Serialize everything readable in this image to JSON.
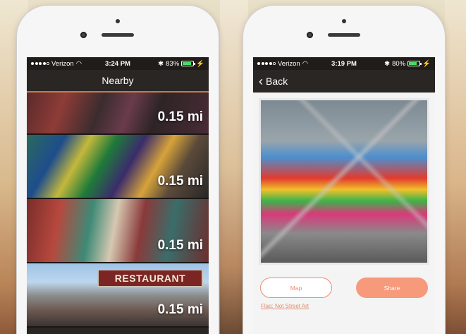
{
  "colors": {
    "accent": "#f7997b",
    "nav_bg": "#2a2623",
    "battery": "#4cd964",
    "link": "#e38a6c"
  },
  "left_phone": {
    "status": {
      "carrier": "Verizon",
      "time": "3:24 PM",
      "battery": "83%",
      "battery_level": 0.83
    },
    "title": "Nearby",
    "items": [
      {
        "distance": "0.15 mi"
      },
      {
        "distance": "0.15 mi"
      },
      {
        "distance": "0.15 mi"
      },
      {
        "distance": "0.15 mi",
        "sign_text": "RESTAURANT"
      }
    ]
  },
  "right_phone": {
    "status": {
      "carrier": "Verizon",
      "time": "3:19 PM",
      "battery": "80%",
      "battery_level": 0.8
    },
    "back_label": "Back",
    "map_label": "Map",
    "share_label": "Share",
    "flag_label": "Flag: Not Street Art"
  }
}
